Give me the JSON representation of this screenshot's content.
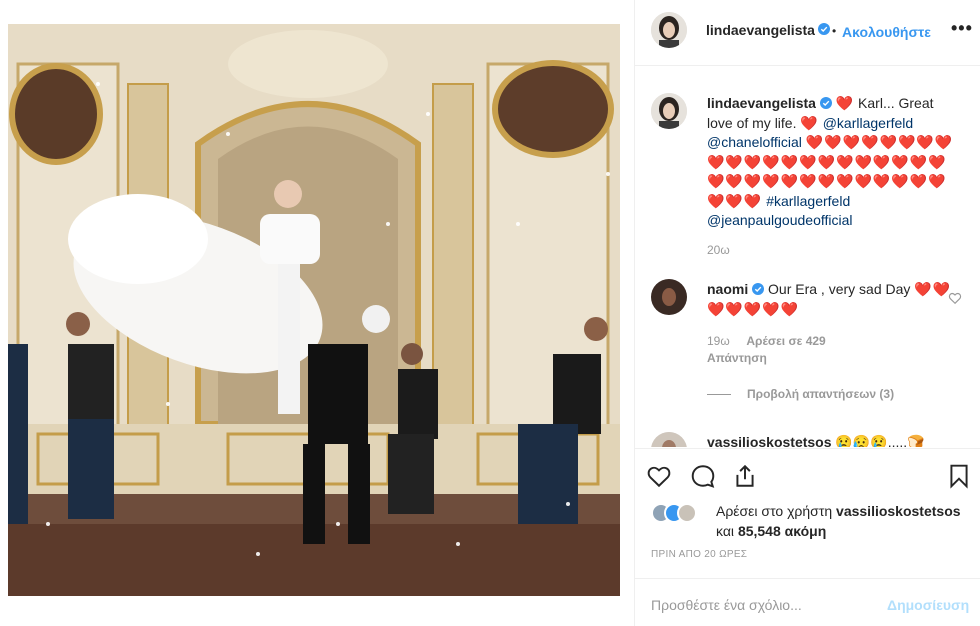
{
  "post": {
    "username": "lindaevangelista",
    "follow_label": "Ακολουθήστε",
    "more_label": "•••",
    "dot": "•"
  },
  "caption": {
    "username": "lindaevangelista",
    "heart_lead": "❤️",
    "text_1": " Karl... Great love of my life. ",
    "heart_2": "❤️",
    "mention_1": "@karllagerfeld",
    "mention_2": "@chanelofficial",
    "hearts_block": "❤️❤️❤️❤️❤️❤️❤️❤️❤️❤️❤️❤️❤️❤️❤️❤️❤️❤️❤️❤️❤️❤️❤️❤️❤️❤️❤️❤️❤️❤️❤️❤️❤️❤️❤️❤️❤️",
    "hashtag": "#karllagerfeld",
    "mention_3": "@jeanpaulgoudeofficial",
    "age": "20ω"
  },
  "comments": [
    {
      "username": "naomi",
      "text": "Our Era , very sad Day",
      "hearts": "❤️❤️❤️❤️❤️❤️❤️",
      "age": "19ω",
      "likes": "Αρέσει σε 429",
      "reply": "Απάντηση",
      "view_replies": "Προβολή απαντήσεων (3)"
    },
    {
      "username": "vassilioskostetsos",
      "text": "😢😥😢.....🍞"
    }
  ],
  "actions": {
    "liked_by_prefix": "Αρέσει στο χρήστη ",
    "liked_by_user": "vassilioskostetsos",
    "and": "και ",
    "others": "85,548 ακόμη",
    "timestamp": "ΠΡΙΝ ΑΠΟ 20 ΩΡΕΣ"
  },
  "comment_box": {
    "placeholder": "Προσθέστε ένα σχόλιο...",
    "post_label": "Δημοσίευση"
  },
  "icons": {
    "like": "heart-icon",
    "comment": "comment-icon",
    "share": "share-icon",
    "save": "bookmark-icon",
    "verified": "verified-badge-icon",
    "more": "more-options-icon"
  },
  "colors": {
    "link": "#003569",
    "accent": "#3897f0",
    "heart": "#ed1c24",
    "muted": "#999999",
    "post_disabled": "#b2dffc"
  }
}
